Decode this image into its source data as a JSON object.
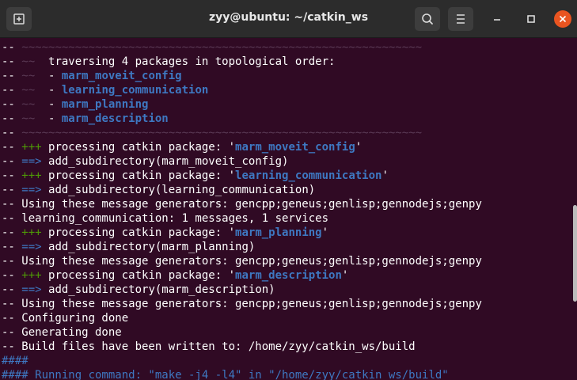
{
  "window": {
    "title": "zyy@ubuntu: ~/catkin_ws"
  },
  "colors": {
    "terminal_bg": "#300a24",
    "titlebar_bg": "#2c2c2c",
    "package_blue": "#3e78c2",
    "plus_green": "#4e9a06",
    "close_orange": "#e95420"
  },
  "icons": {
    "new_tab": "new-tab-icon",
    "search": "search-icon",
    "menu": "hamburger-menu-icon",
    "minimize": "minimize-icon",
    "maximize": "maximize-icon",
    "close": "close-icon"
  },
  "terminal": {
    "lines": [
      [
        {
          "t": "-- "
        },
        {
          "t": "~~~~~~~~~~~~~~~~~~~~~~~~~~~~~~~~~~~~~~~~~~~~~~~~~~~~~~~~~~~~",
          "c": "tilde"
        }
      ],
      [
        {
          "t": "-- "
        },
        {
          "t": "~~",
          "c": "tilde"
        },
        {
          "t": "  traversing 4 packages in topological order:"
        }
      ],
      [
        {
          "t": "-- "
        },
        {
          "t": "~~",
          "c": "tilde"
        },
        {
          "t": "  - "
        },
        {
          "t": "marm_moveit_config",
          "c": "pkg"
        }
      ],
      [
        {
          "t": "-- "
        },
        {
          "t": "~~",
          "c": "tilde"
        },
        {
          "t": "  - "
        },
        {
          "t": "learning_communication",
          "c": "pkg"
        }
      ],
      [
        {
          "t": "-- "
        },
        {
          "t": "~~",
          "c": "tilde"
        },
        {
          "t": "  - "
        },
        {
          "t": "marm_planning",
          "c": "pkg"
        }
      ],
      [
        {
          "t": "-- "
        },
        {
          "t": "~~",
          "c": "tilde"
        },
        {
          "t": "  - "
        },
        {
          "t": "marm_description",
          "c": "pkg"
        }
      ],
      [
        {
          "t": "-- "
        },
        {
          "t": "~~~~~~~~~~~~~~~~~~~~~~~~~~~~~~~~~~~~~~~~~~~~~~~~~~~~~~~~~~~~",
          "c": "tilde"
        }
      ],
      [
        {
          "t": "-- "
        },
        {
          "t": "+++",
          "c": "plus"
        },
        {
          "t": " processing catkin package: '"
        },
        {
          "t": "marm_moveit_config",
          "c": "pkg"
        },
        {
          "t": "'"
        }
      ],
      [
        {
          "t": "-- "
        },
        {
          "t": "==>",
          "c": "arrow"
        },
        {
          "t": " add_subdirectory(marm_moveit_config)"
        }
      ],
      [
        {
          "t": "-- "
        },
        {
          "t": "+++",
          "c": "plus"
        },
        {
          "t": " processing catkin package: '"
        },
        {
          "t": "learning_communication",
          "c": "pkg"
        },
        {
          "t": "'"
        }
      ],
      [
        {
          "t": "-- "
        },
        {
          "t": "==>",
          "c": "arrow"
        },
        {
          "t": " add_subdirectory(learning_communication)"
        }
      ],
      [
        {
          "t": "-- Using these message generators: gencpp;geneus;genlisp;gennodejs;genpy"
        }
      ],
      [
        {
          "t": "-- learning_communication: 1 messages, 1 services"
        }
      ],
      [
        {
          "t": "-- "
        },
        {
          "t": "+++",
          "c": "plus"
        },
        {
          "t": " processing catkin package: '"
        },
        {
          "t": "marm_planning",
          "c": "pkg"
        },
        {
          "t": "'"
        }
      ],
      [
        {
          "t": "-- "
        },
        {
          "t": "==>",
          "c": "arrow"
        },
        {
          "t": " add_subdirectory(marm_planning)"
        }
      ],
      [
        {
          "t": "-- Using these message generators: gencpp;geneus;genlisp;gennodejs;genpy"
        }
      ],
      [
        {
          "t": "-- "
        },
        {
          "t": "+++",
          "c": "plus"
        },
        {
          "t": " processing catkin package: '"
        },
        {
          "t": "marm_description",
          "c": "pkg"
        },
        {
          "t": "'"
        }
      ],
      [
        {
          "t": "-- "
        },
        {
          "t": "==>",
          "c": "arrow"
        },
        {
          "t": " add_subdirectory(marm_description)"
        }
      ],
      [
        {
          "t": "-- Using these message generators: gencpp;geneus;genlisp;gennodejs;genpy"
        }
      ],
      [
        {
          "t": "-- Configuring done"
        }
      ],
      [
        {
          "t": "-- Generating done"
        }
      ],
      [
        {
          "t": "-- Build files have been written to: /home/zyy/catkin_ws/build"
        }
      ],
      [
        {
          "t": "####",
          "c": "hash"
        }
      ],
      [
        {
          "t": "#### Running command: \"make -j4 -l4\" in \"/home/zyy/catkin_ws/build\"",
          "c": "hash"
        }
      ]
    ]
  }
}
